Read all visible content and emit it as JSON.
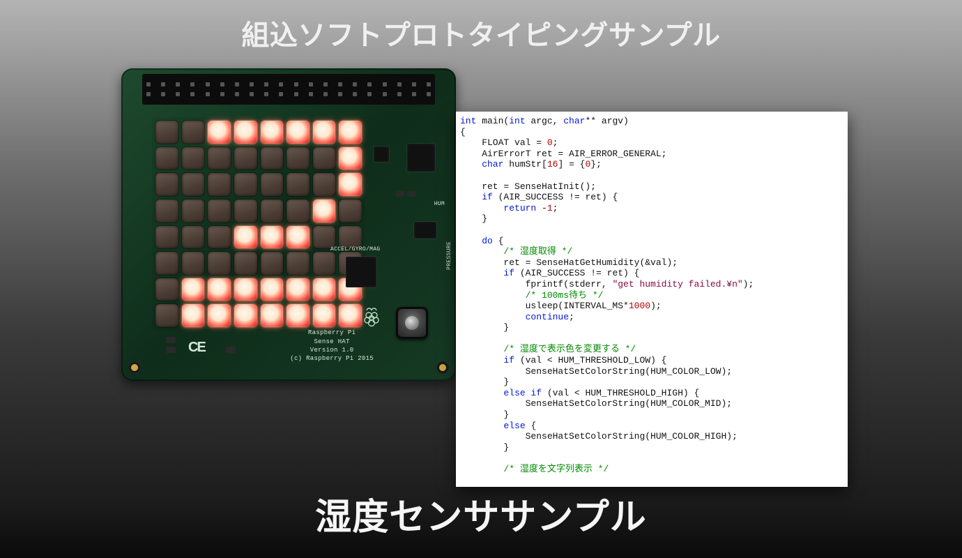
{
  "titles": {
    "top": "組込ソフトプロトタイピングサンプル",
    "bottom": "湿度センササンプル"
  },
  "board": {
    "silk_brand_l1": "Raspberry Pi",
    "silk_brand_l2": "Sense HAT",
    "silk_brand_l3": "Version 1.0",
    "silk_brand_l4": "(c) Raspberry Pi 2015",
    "silk_accel": "ACCEL/GYRO/MAG",
    "silk_pressure": "PRESSURE",
    "silk_hum": "HUM",
    "ce_mark": "CE"
  },
  "led_rows": [
    "00111111",
    "00000001",
    "00000001",
    "00000010",
    "00011100",
    "00000000",
    "01111111",
    "01111111"
  ],
  "code": {
    "sig_1": "int",
    "sig_2": " main(",
    "sig_3": "int",
    "sig_4": " argc, ",
    "sig_5": "char",
    "sig_6": "** argv)",
    "brace_open": "{",
    "l1a": "    FLOAT val = ",
    "l1n": "0",
    "l1b": ";",
    "l2": "    AirErrorT ret = AIR_ERROR_GENERAL;",
    "l3a": "    ",
    "l3k": "char",
    "l3b": " humStr[",
    "l3n1": "16",
    "l3c": "] = {",
    "l3n2": "0",
    "l3d": "};",
    "l5": "    ret = SenseHatInit();",
    "l6a": "    ",
    "l6k": "if",
    "l6b": " (AIR_SUCCESS != ret) {",
    "l7a": "        ",
    "l7k": "return",
    "l7b": " -",
    "l7n": "1",
    "l7c": ";",
    "l8": "    }",
    "l10a": "    ",
    "l10k": "do",
    "l10b": " {",
    "c1": "        /* 湿度取得 */",
    "l12": "        ret = SenseHatGetHumidity(&val);",
    "l13a": "        ",
    "l13k": "if",
    "l13b": " (AIR_SUCCESS != ret) {",
    "l14a": "            fprintf(stderr, ",
    "l14s": "\"get humidity failed.¥n\"",
    "l14b": ");",
    "c2": "            /* 100ms待ち */",
    "l16a": "            usleep(INTERVAL_MS*",
    "l16n": "1000",
    "l16b": ");",
    "l17a": "            ",
    "l17k": "continue",
    "l17b": ";",
    "l18": "        }",
    "c3": "        /* 湿度で表示色を変更する */",
    "l20a": "        ",
    "l20k": "if",
    "l20b": " (val < HUM_THRESHOLD_LOW) {",
    "l21": "            SenseHatSetColorString(HUM_COLOR_LOW);",
    "l22": "        }",
    "l23a": "        ",
    "l23k": "else if",
    "l23b": " (val < HUM_THRESHOLD_HIGH) {",
    "l24": "            SenseHatSetColorString(HUM_COLOR_MID);",
    "l25": "        }",
    "l26a": "        ",
    "l26k": "else",
    "l26b": " {",
    "l27": "            SenseHatSetColorString(HUM_COLOR_HIGH);",
    "l28": "        }",
    "c4": "        /* 湿度を文字列表示 */"
  }
}
